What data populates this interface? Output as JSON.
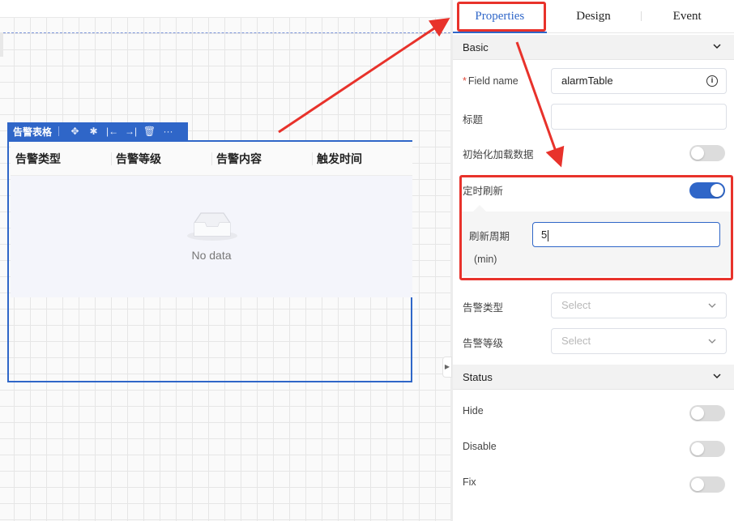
{
  "canvas": {
    "widget": {
      "toolbar_title": "告警表格",
      "toolbar_icons": [
        "move-icon",
        "settings-icon",
        "align-left-icon",
        "align-right-icon",
        "delete-icon",
        "more-icon"
      ],
      "toolbar_glyphs": [
        "✥",
        "✱",
        "|←",
        "→|",
        "🗑",
        "···"
      ],
      "columns": [
        "告警类型",
        "告警等级",
        "告警内容",
        "触发时间"
      ],
      "empty_text": "No data"
    }
  },
  "panel": {
    "tabs": [
      {
        "label": "Properties",
        "active": true
      },
      {
        "label": "Design",
        "active": false
      },
      {
        "label": "Event",
        "active": false
      }
    ],
    "basic": {
      "title": "Basic",
      "field_name_label": "Field name",
      "field_name_value": "alarmTable",
      "title_label": "标题",
      "title_value": "",
      "init_load_label": "初始化加载数据",
      "timed_refresh_label": "定时刷新",
      "refresh_period_label": "刷新周期",
      "refresh_period_unit": "(min)",
      "refresh_period_value": "5",
      "alarm_type_label": "告警类型",
      "alarm_type_placeholder": "Select",
      "alarm_level_label": "告警等级",
      "alarm_level_placeholder": "Select"
    },
    "status": {
      "title": "Status",
      "hide_label": "Hide",
      "disable_label": "Disable",
      "fix_label": "Fix"
    }
  },
  "toggles": {
    "init_load": false,
    "timed_refresh": true,
    "hide": false,
    "disable": false,
    "fix": false
  },
  "colors": {
    "accent": "#2f66c8",
    "annotation": "#e8322b"
  }
}
